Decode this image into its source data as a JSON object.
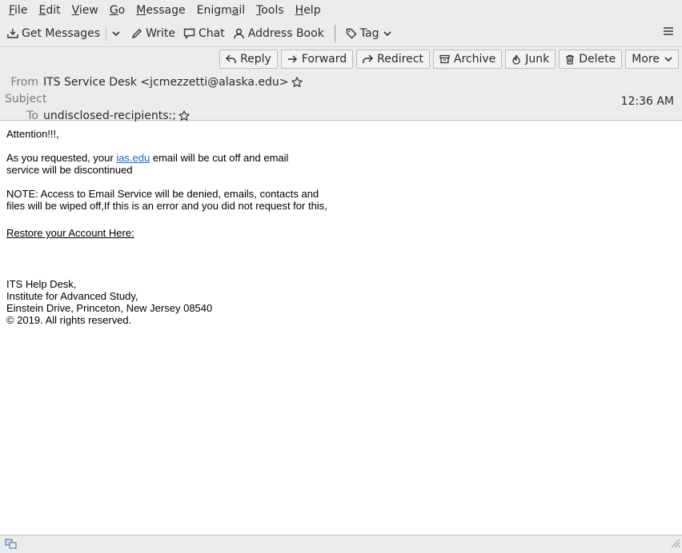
{
  "menu": {
    "file": {
      "pre": "",
      "u": "F",
      "post": "ile"
    },
    "edit": {
      "pre": "",
      "u": "E",
      "post": "dit"
    },
    "view": {
      "pre": "",
      "u": "V",
      "post": "iew"
    },
    "go": {
      "pre": "",
      "u": "G",
      "post": "o"
    },
    "message": {
      "pre": "",
      "u": "M",
      "post": "essage"
    },
    "enigmail": {
      "pre": "Enigm",
      "u": "a",
      "post": "il"
    },
    "tools": {
      "pre": "",
      "u": "T",
      "post": "ools"
    },
    "help": {
      "pre": "",
      "u": "H",
      "post": "elp"
    }
  },
  "toolbar": {
    "get_messages": "Get Messages",
    "write": "Write",
    "chat": "Chat",
    "address_book": "Address Book",
    "tag": "Tag"
  },
  "actions": {
    "reply": "Reply",
    "forward": "Forward",
    "redirect": "Redirect",
    "archive": "Archive",
    "junk": "Junk",
    "delete": "Delete",
    "more": "More"
  },
  "header": {
    "from_label": "From",
    "from_value": "ITS Service Desk <jcmezzetti@alaska.edu>",
    "subject_label": "Subject",
    "to_label": "To",
    "to_value": "undisclosed-recipients:;",
    "time": "12:36 AM"
  },
  "body": {
    "greeting": "Attention!!!,",
    "p1_pre": "As you requested, your ",
    "p1_link": "ias.edu",
    "p1_post": " email will be cut off and email",
    "p1_line2": "service will be discontinued",
    "p2_line1": "NOTE: Access to Email Service will be denied, emails, contacts and",
    "p2_line2": "files will be wiped off,If this is an error and you did not request for this,",
    "restore": "Restore your Account Here:",
    "sig1": "ITS Help Desk,",
    "sig2": "Institute for Advanced Study,",
    "sig3": "Einstein Drive, Princeton, New Jersey 08540",
    "sig4": "© 2019. All rights reserved."
  }
}
